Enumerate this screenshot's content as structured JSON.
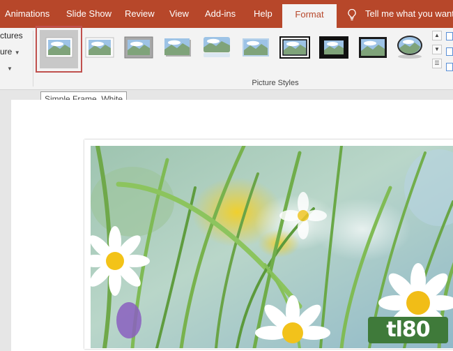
{
  "tabs": [
    {
      "label": "Animations",
      "active": false
    },
    {
      "label": "Slide Show",
      "active": false
    },
    {
      "label": "Review",
      "active": false
    },
    {
      "label": "View",
      "active": false
    },
    {
      "label": "Add-ins",
      "active": false
    },
    {
      "label": "Help",
      "active": false
    },
    {
      "label": "Format",
      "active": true
    }
  ],
  "tell_me": {
    "text": "Tell me what you want t",
    "icon": "lightbulb-icon"
  },
  "ribbon": {
    "left_commands": [
      "ctures",
      "ure",
      ""
    ],
    "group_label": "Picture Styles",
    "styles": [
      "Simple Frame, White",
      "Beveled Matte, White",
      "Metal Frame",
      "Drop Shadow Rectangle",
      "Reflected Rounded Rectangle",
      "Soft Edge Rectangle",
      "Double Frame, Black",
      "Thick Matte, Black",
      "Simple Frame, Black",
      "Oval"
    ],
    "selected_style_index": 0
  },
  "tooltip": {
    "text": "Simple Frame, White"
  },
  "watermark": {
    "text": "tl80"
  },
  "colors": {
    "accent": "#b7472a",
    "ribbon_bg": "#f3f3f3",
    "selection_border": "#c0504d"
  }
}
